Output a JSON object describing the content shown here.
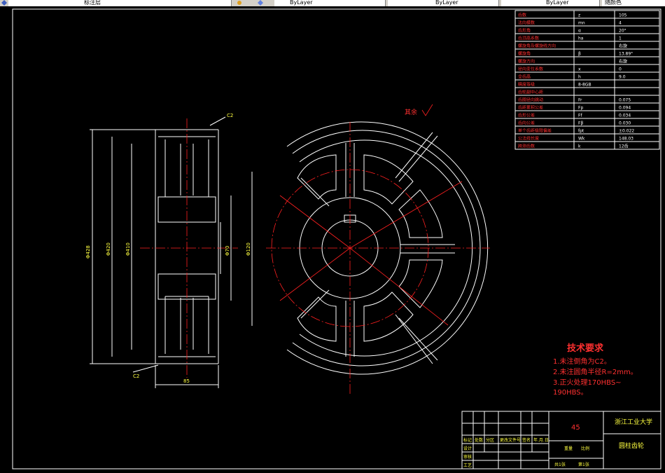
{
  "toolbar": {
    "tabs": [
      {
        "label": "标注层"
      },
      {
        "label": "ByLayer"
      },
      {
        "label": "ByLayer"
      },
      {
        "label": "ByLayer"
      },
      {
        "label": "随颜色"
      }
    ]
  },
  "drawing": {
    "surface_mark": "其余",
    "tech_req": {
      "title": "技术要求",
      "items": [
        "1.未注倒角为C2。",
        "2.未注圆角半径R=2mm。",
        "3.正火处理170HBS~",
        "190HBS。"
      ]
    },
    "param_table": {
      "rows": [
        {
          "label": "齿数",
          "sym": "z",
          "val": "105"
        },
        {
          "label": "法向模数",
          "sym": "mn",
          "val": "4"
        },
        {
          "label": "齿形角",
          "sym": "α",
          "val": "20°"
        },
        {
          "label": "齿顶高系数",
          "sym": "ha",
          "val": "1"
        },
        {
          "label": "螺旋角及螺旋线方向",
          "sym": "",
          "val": "右旋"
        },
        {
          "label": "螺旋角",
          "sym": "β",
          "val": "13.89°"
        },
        {
          "label": "螺旋方向",
          "sym": "",
          "val": "右旋"
        },
        {
          "label": "径向变位系数",
          "sym": "x",
          "val": "0"
        },
        {
          "label": "全齿高",
          "sym": "h",
          "val": "9.0"
        },
        {
          "label": "精度等级",
          "sym": "8-8GB",
          "val": ""
        },
        {
          "label": "齿轮副中心距",
          "sym": "",
          "val": ""
        },
        {
          "label": "齿圈径向跳动",
          "sym": "Fr",
          "val": "0.075"
        },
        {
          "label": "齿距累积公差",
          "sym": "Fp",
          "val": "0.094"
        },
        {
          "label": "齿形公差",
          "sym": "Ff",
          "val": "0.034"
        },
        {
          "label": "齿向公差",
          "sym": "Fβ",
          "val": "0.030"
        },
        {
          "label": "单个齿距极限偏差",
          "sym": "fpt",
          "val": "±0.022"
        },
        {
          "label": "公法线长度",
          "sym": "Wk",
          "val": "148.03"
        },
        {
          "label": "跨测齿数",
          "sym": "k",
          "val": "12齿"
        }
      ]
    },
    "title_block": {
      "material": "45",
      "school": "浙江工业大学",
      "drawing_name": "圆柱齿轮",
      "scale_label": "比例",
      "weight_label": "重量",
      "sheet_total": "共1张",
      "sheet_no": "第1张",
      "row_labels": [
        "标记",
        "设计",
        "审核",
        "工艺"
      ],
      "header_labels": [
        "处数",
        "分区",
        "更改文件号",
        "签名",
        "年.月.日"
      ]
    },
    "side_dims": {
      "da": "Φ428",
      "d": "Φ420",
      "df": "Φ410",
      "hub": "Φ120",
      "bore": "Φ70",
      "width": "85",
      "chamfer1": "C2",
      "chamfer2": "C2"
    }
  },
  "colors": {
    "background": "#000000",
    "outline": "#ffffff",
    "centerline": "#ff2020",
    "text": "#ffff40"
  }
}
